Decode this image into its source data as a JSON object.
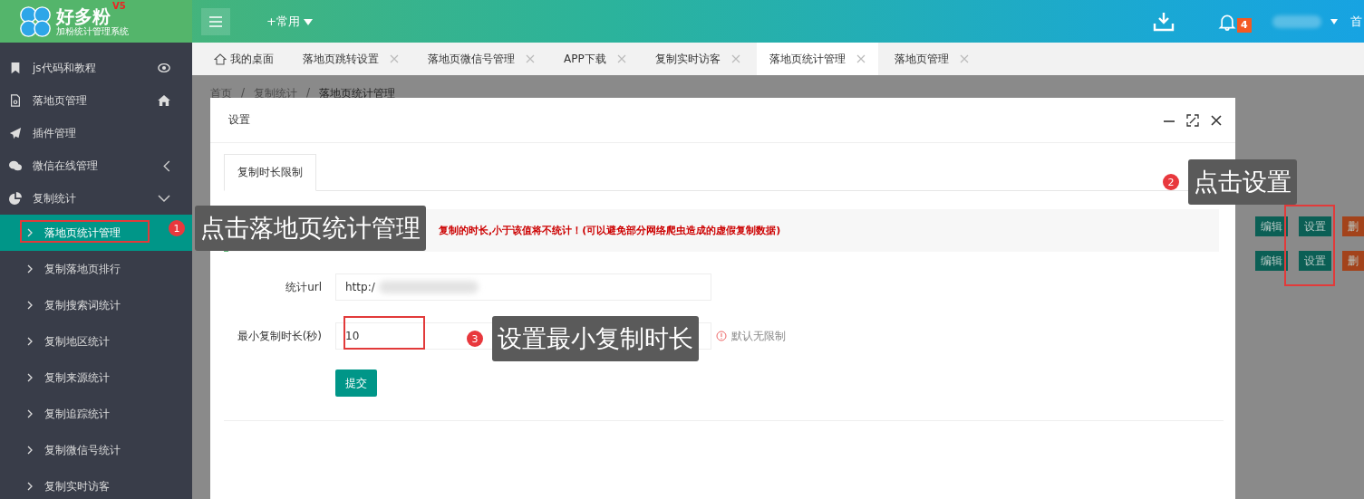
{
  "header": {
    "logo": {
      "name": "好多粉",
      "version": "V5",
      "subtitle": "加粉统计管理系统"
    },
    "quick_menu": "+常用",
    "notification_count": "4",
    "edge_text": "首"
  },
  "sidebar": {
    "items": [
      {
        "label": "js代码和教程"
      },
      {
        "label": "落地页管理"
      },
      {
        "label": "插件管理"
      },
      {
        "label": "微信在线管理",
        "expanded": false
      },
      {
        "label": "复制统计",
        "expanded": true,
        "children": [
          {
            "label": "落地页统计管理",
            "selected": true
          },
          {
            "label": "复制落地页排行",
            "selected": false
          },
          {
            "label": "复制搜索词统计",
            "selected": false
          },
          {
            "label": "复制地区统计",
            "selected": false
          },
          {
            "label": "复制来源统计",
            "selected": false
          },
          {
            "label": "复制追踪统计",
            "selected": false
          },
          {
            "label": "复制微信号统计",
            "selected": false
          },
          {
            "label": "复制实时访客",
            "selected": false
          }
        ]
      }
    ]
  },
  "tabs": [
    {
      "label": "我的桌面",
      "kind": "home",
      "selected": false
    },
    {
      "label": "落地页跳转设置",
      "kind": "page",
      "selected": false
    },
    {
      "label": "落地页微信号管理",
      "kind": "page",
      "selected": false
    },
    {
      "label": "APP下载",
      "kind": "page",
      "selected": false
    },
    {
      "label": "复制实时访客",
      "kind": "page",
      "selected": false
    },
    {
      "label": "落地页统计管理",
      "kind": "page",
      "selected": true
    },
    {
      "label": "落地页管理",
      "kind": "page",
      "selected": false
    }
  ],
  "breadcrumb": {
    "separator": "/",
    "items": [
      "首页",
      "复制统计",
      "落地页统计管理"
    ]
  },
  "background_table": {
    "rows": [
      {
        "buttons": [
          "编辑",
          "设置",
          "删"
        ]
      },
      {
        "buttons": [
          "编辑",
          "设置",
          "删"
        ]
      }
    ]
  },
  "dialog": {
    "title": "设置",
    "tabs": [
      {
        "label": "复制时长限制",
        "selected": true
      }
    ],
    "notice": "复制的时长,小于该值将不统计！(可以避免部分网络爬虫造成的虚假复制数据)",
    "fields": [
      {
        "label": "统计url",
        "value": "http:/",
        "blurred": true
      },
      {
        "label": "最小复制时长(秒)",
        "value": "10",
        "hint": "默认无限制"
      }
    ],
    "submit": "提交"
  },
  "callouts": [
    {
      "number": "1",
      "text": "点击落地页统计管理"
    },
    {
      "number": "2",
      "text": "点击设置"
    },
    {
      "number": "3",
      "text": "设置最小复制时长"
    }
  ]
}
